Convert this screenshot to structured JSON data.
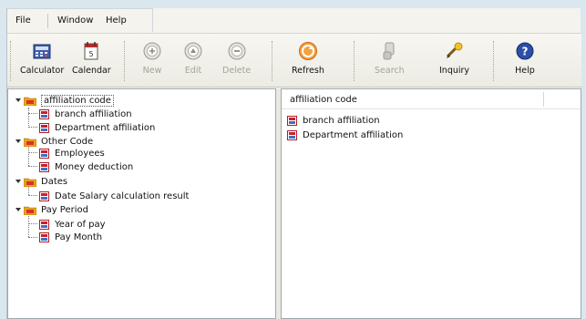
{
  "menu": {
    "file": "File",
    "window": "Window",
    "help": "Help"
  },
  "toolbar": {
    "calculator": "Calculator",
    "calendar": "Calendar",
    "new": "New",
    "edit": "Edit",
    "delete": "Delete",
    "refresh": "Refresh",
    "search": "Search",
    "inquiry": "Inquiry",
    "help": "Help"
  },
  "tree": {
    "groups": [
      {
        "label": "affiliation code",
        "children": [
          "branch affiliation",
          "Department affiliation"
        ]
      },
      {
        "label": "Other Code",
        "children": [
          "Employees",
          "Money deduction"
        ]
      },
      {
        "label": "Dates",
        "children": [
          "Date Salary calculation result"
        ]
      },
      {
        "label": "Pay Period",
        "children": [
          "Year of pay",
          "Pay Month"
        ]
      }
    ]
  },
  "list": {
    "header": "affiliation code",
    "items": [
      "branch affiliation",
      "Department affiliation"
    ]
  },
  "colors": {
    "folder": "#e8a31c",
    "doc": "#c8202a",
    "help": "#2a4fa8",
    "refresh": "#f08a1a"
  }
}
